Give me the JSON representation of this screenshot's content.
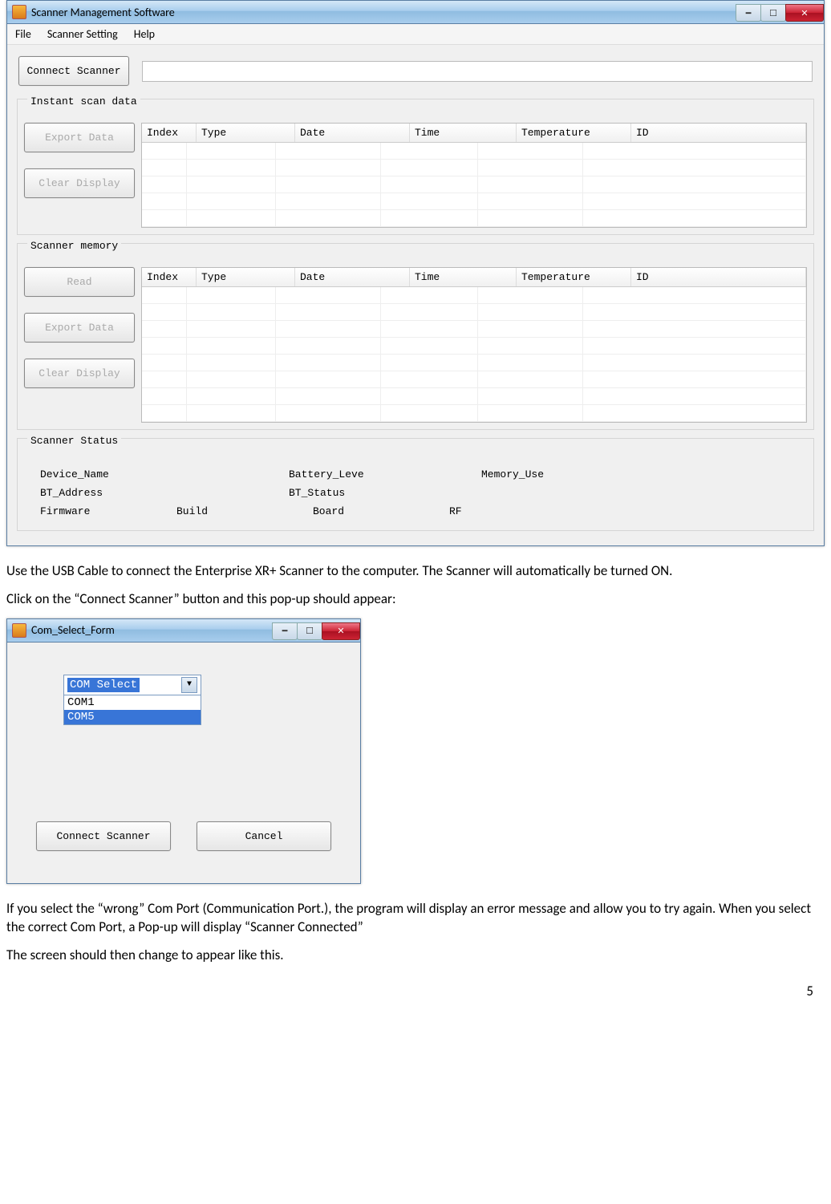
{
  "window1": {
    "title": "Scanner Management Software",
    "menu": {
      "file": "File",
      "scanner_setting": "Scanner Setting",
      "help": "Help"
    },
    "connect_btn": "Connect Scanner",
    "instant": {
      "title": "Instant scan data",
      "export": "Export Data",
      "clear": "Clear Display"
    },
    "columns": {
      "index": "Index",
      "type": "Type",
      "date": "Date",
      "time": "Time",
      "temp": "Temperature",
      "id": "ID"
    },
    "memory": {
      "title": "Scanner memory",
      "read": "Read",
      "export": "Export Data",
      "clear": "Clear Display"
    },
    "status": {
      "title": "Scanner Status",
      "device_name": "Device_Name",
      "battery": "Battery_Leve",
      "memory_use": "Memory_Use",
      "bt_address": "BT_Address",
      "bt_status": "BT_Status",
      "firmware": "Firmware",
      "build": "Build",
      "board": "Board",
      "rf": "RF"
    }
  },
  "prose1": "Use the USB Cable to connect the Enterprise XR+ Scanner to the computer.  The Scanner will automatically be turned ON.",
  "prose2": "Click on the “Connect Scanner” button and this pop-up should appear:",
  "window2": {
    "title": "Com_Select_Form",
    "combo_label": "COM Select",
    "options": [
      "COM1",
      "COM5"
    ],
    "connect": "Connect Scanner",
    "cancel": "Cancel"
  },
  "prose3": "If you select the “wrong” Com Port (Communication Port.), the program will display an error message and allow you to try again.  When you select the correct Com Port, a Pop-up will display “Scanner Connected”",
  "prose4": "The screen should then change to appear like this.",
  "page_number": "5"
}
